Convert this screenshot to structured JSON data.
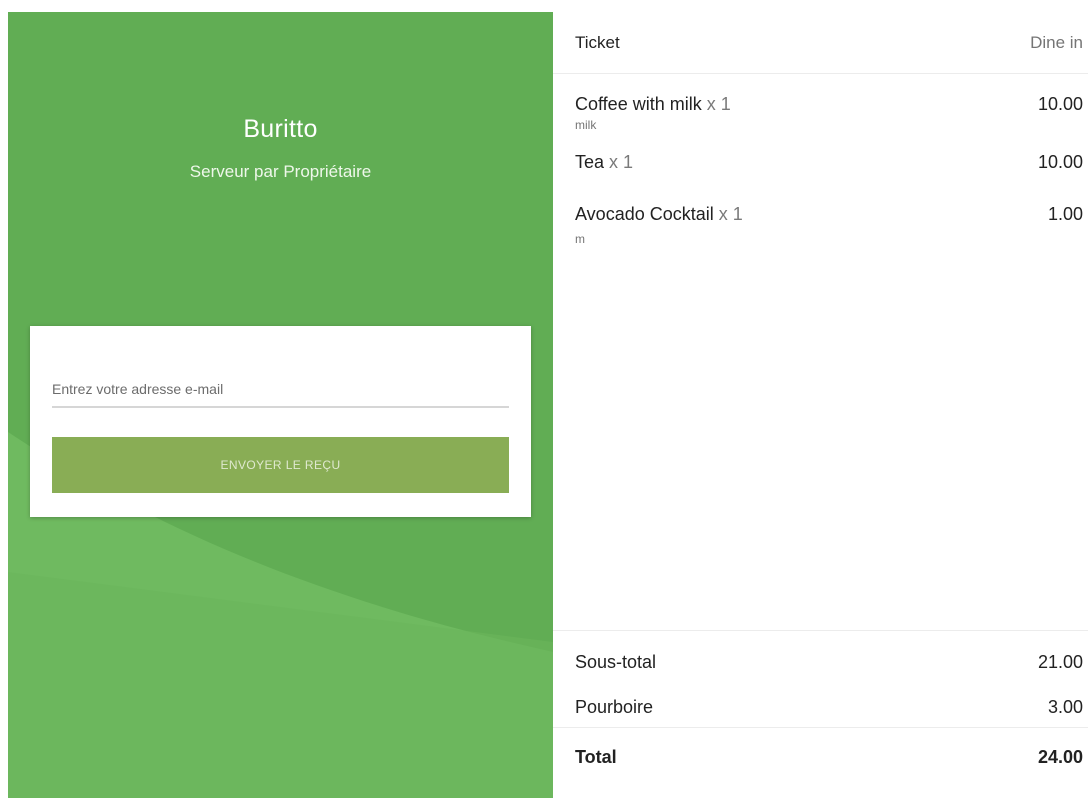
{
  "brand": {
    "store_name": "Buritto",
    "subtitle": "Serveur par Propriétaire",
    "background_color": "#61ad54"
  },
  "email_form": {
    "placeholder": "Entrez votre adresse e-mail",
    "value": "",
    "send_button_label": "ENVOYER LE REÇU",
    "send_button_color": "#89ad55"
  },
  "ticket": {
    "title": "Ticket",
    "dining_option": "Dine in",
    "items": [
      {
        "name": "Coffee with milk",
        "quantity": "x 1",
        "note": "milk",
        "price": "10.00"
      },
      {
        "name": "Tea",
        "quantity": "x 1",
        "note": "",
        "price": "10.00"
      },
      {
        "name": "Avocado Cocktail",
        "quantity": "x 1",
        "note": "m",
        "price": "1.00"
      }
    ],
    "subtotal_label": "Sous-total",
    "subtotal_value": "21.00",
    "tip_label": "Pourboire",
    "tip_value": "3.00",
    "total_label": "Total",
    "total_value": "24.00"
  }
}
